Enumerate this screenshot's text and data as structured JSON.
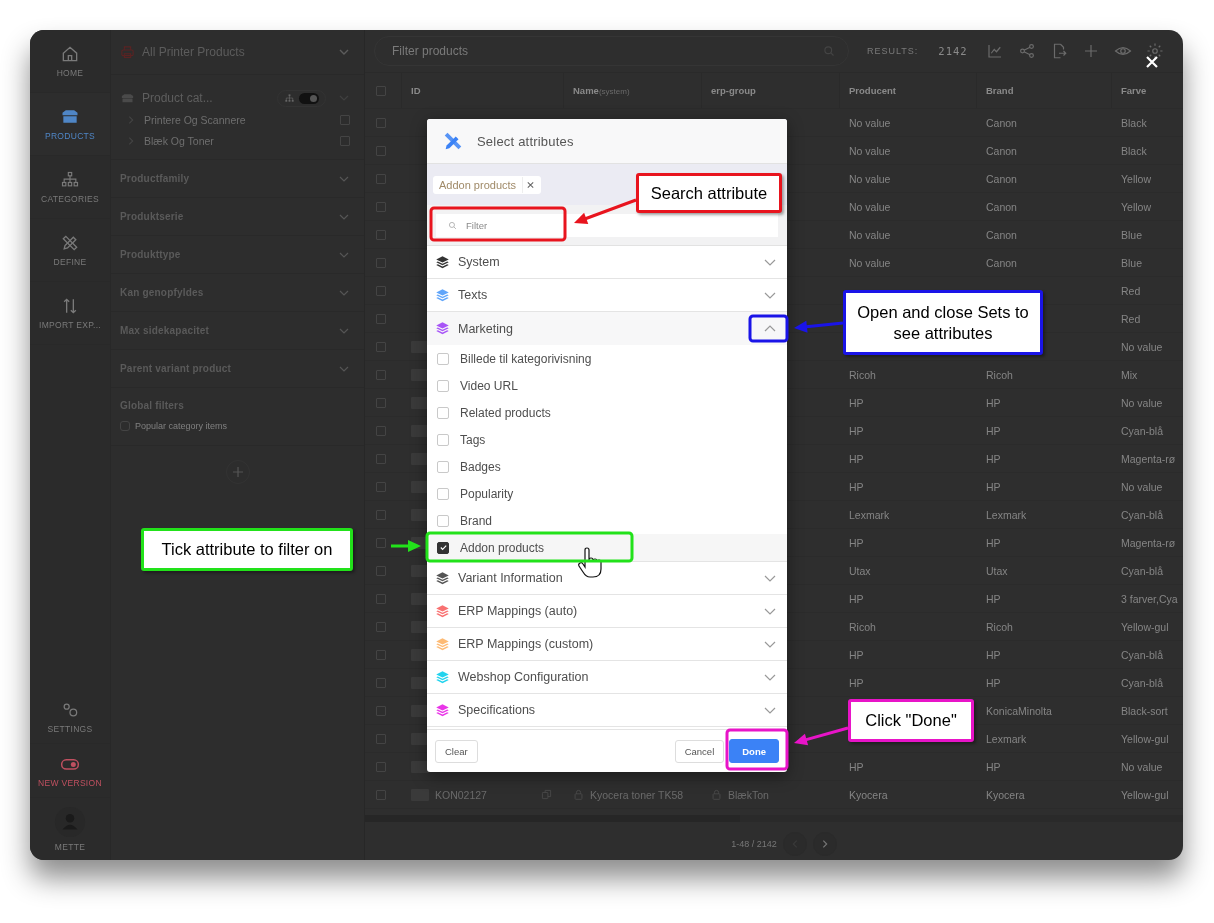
{
  "nav": {
    "top": [
      {
        "label": "HOME",
        "selected": false
      },
      {
        "label": "PRODUCTS",
        "selected": true
      },
      {
        "label": "CATEGORIES",
        "selected": false
      },
      {
        "label": "DEFINE",
        "selected": false
      },
      {
        "label": "IMPORT EXP...",
        "selected": false
      }
    ],
    "bottom": [
      {
        "label": "SETTINGS",
        "kind": "settings"
      },
      {
        "label": "NEW VERSION",
        "kind": "toggle"
      },
      {
        "label": "METTE",
        "kind": "user"
      }
    ]
  },
  "sidebar": {
    "catalog": "All Printer Products",
    "category_panel": {
      "title": "Product cat...",
      "tree_view": true,
      "items": [
        {
          "label": "Printere Og Scannere",
          "checked": false
        },
        {
          "label": "Blæk Og Toner",
          "checked": false
        }
      ]
    },
    "filters": [
      "Productfamily",
      "Produktserie",
      "Produkttype",
      "Kan genopfyldes",
      "Max sidekapacitet",
      "Parent variant product"
    ],
    "global_filters": {
      "title": "Global filters",
      "items": [
        {
          "label": "Popular category items",
          "checked": false
        }
      ]
    }
  },
  "toolbar": {
    "search": {
      "placeholder": "Filter products"
    },
    "results_label": "RESULTS:",
    "results_count": "2142"
  },
  "table": {
    "all_selected": false,
    "columns": [
      {
        "label": "ID"
      },
      {
        "label": "Name",
        "note": "(system)"
      },
      {
        "label": "erp-group"
      },
      {
        "label": "Producent"
      },
      {
        "label": "Brand"
      },
      {
        "label": "Farve"
      }
    ],
    "rows": [
      {
        "checked": false,
        "image": false,
        "producent": "No value",
        "brand": "Canon",
        "farve": "Black"
      },
      {
        "checked": false,
        "image": false,
        "producent": "No value",
        "brand": "Canon",
        "farve": "Black"
      },
      {
        "checked": false,
        "image": false,
        "producent": "No value",
        "brand": "Canon",
        "farve": "Yellow"
      },
      {
        "checked": false,
        "image": false,
        "producent": "No value",
        "brand": "Canon",
        "farve": "Yellow"
      },
      {
        "checked": false,
        "image": false,
        "producent": "No value",
        "brand": "Canon",
        "farve": "Blue"
      },
      {
        "checked": false,
        "image": false,
        "producent": "No value",
        "brand": "Canon",
        "farve": "Blue"
      },
      {
        "checked": false,
        "image": false,
        "farve": "Red"
      },
      {
        "checked": false,
        "image": false,
        "farve": "Red"
      },
      {
        "checked": false,
        "image": true,
        "farve": "No value"
      },
      {
        "checked": false,
        "image": true,
        "producent": "Ricoh",
        "brand": "Ricoh",
        "farve": "Mix"
      },
      {
        "checked": false,
        "image": true,
        "producent": "HP",
        "brand": "HP",
        "farve": "No value"
      },
      {
        "checked": false,
        "image": true,
        "producent": "HP",
        "brand": "HP",
        "farve": "Cyan-blå"
      },
      {
        "checked": false,
        "image": true,
        "producent": "HP",
        "brand": "HP",
        "farve": "Magenta-rø"
      },
      {
        "checked": false,
        "image": true,
        "producent": "HP",
        "brand": "HP",
        "farve": "No value"
      },
      {
        "checked": false,
        "image": true,
        "producent": "Lexmark",
        "brand": "Lexmark",
        "farve": "Cyan-blå"
      },
      {
        "checked": false,
        "image": true,
        "producent": "HP",
        "brand": "HP",
        "farve": "Magenta-rø"
      },
      {
        "checked": false,
        "image": true,
        "producent": "Utax",
        "brand": "Utax",
        "farve": "Cyan-blå"
      },
      {
        "checked": false,
        "image": true,
        "producent": "HP",
        "brand": "HP",
        "farve": "3 farver,Cya"
      },
      {
        "checked": false,
        "image": true,
        "producent": "Ricoh",
        "brand": "Ricoh",
        "farve": "Yellow-gul"
      },
      {
        "checked": false,
        "image": true,
        "producent": "HP",
        "brand": "HP",
        "farve": "Cyan-blå"
      },
      {
        "checked": false,
        "image": true,
        "producent": "HP",
        "brand": "HP",
        "farve": "Cyan-blå"
      },
      {
        "checked": false,
        "image": true,
        "brand": "KonicaMinolta",
        "farve": "Black-sort"
      },
      {
        "checked": false,
        "image": true,
        "brand": "Lexmark",
        "farve": "Yellow-gul"
      },
      {
        "checked": false,
        "image": true,
        "producent": "HP",
        "brand": "HP",
        "farve": "No value"
      },
      {
        "checked": false,
        "image": true,
        "id": "KON02127",
        "name": "Kyocera toner TK58",
        "erp_group": "BlækTon",
        "producent": "Kyocera",
        "brand": "Kyocera",
        "farve": "Yellow-gul"
      }
    ]
  },
  "pagination": {
    "range": "1-48 / 2142"
  },
  "dialog": {
    "title": "Select attributes",
    "chips": [
      {
        "label": "Addon products"
      }
    ],
    "filter": {
      "placeholder": "Filter"
    },
    "sets": [
      {
        "name": "System",
        "color": "#333333",
        "expanded": false
      },
      {
        "name": "Texts",
        "color": "#60a5fa",
        "expanded": false
      },
      {
        "name": "Marketing",
        "color": "#a855f7",
        "expanded": true,
        "attributes": [
          {
            "label": "Billede til kategorivisning",
            "checked": false,
            "hovered": false
          },
          {
            "label": "Video URL",
            "checked": false,
            "hovered": false
          },
          {
            "label": "Related products",
            "checked": false,
            "hovered": false
          },
          {
            "label": "Tags",
            "checked": false,
            "hovered": false
          },
          {
            "label": "Badges",
            "checked": false,
            "hovered": false
          },
          {
            "label": "Popularity",
            "checked": false,
            "hovered": false
          },
          {
            "label": "Brand",
            "checked": false,
            "hovered": false
          },
          {
            "label": "Addon products",
            "checked": true,
            "hovered": true
          }
        ]
      },
      {
        "name": "Variant Information",
        "color": "#555555",
        "expanded": false
      },
      {
        "name": "ERP Mappings (auto)",
        "color": "#f87171",
        "expanded": false
      },
      {
        "name": "ERP Mappings (custom)",
        "color": "#fdba74",
        "expanded": false
      },
      {
        "name": "Webshop Configuration",
        "color": "#22d3ee",
        "expanded": false
      },
      {
        "name": "Specifications",
        "color": "#e935e8",
        "expanded": false
      }
    ],
    "buttons": {
      "clear": "Clear",
      "cancel": "Cancel",
      "done": "Done"
    }
  },
  "callouts": [
    {
      "text": "Search attribute",
      "color": "#e8141e"
    },
    {
      "text": "Open and close Sets to see attributes",
      "color": "#1a14e8"
    },
    {
      "text": "Tick attribute to filter on",
      "color": "#22e21a"
    },
    {
      "text": "Click \"Done\"",
      "color": "#e814c8"
    }
  ]
}
